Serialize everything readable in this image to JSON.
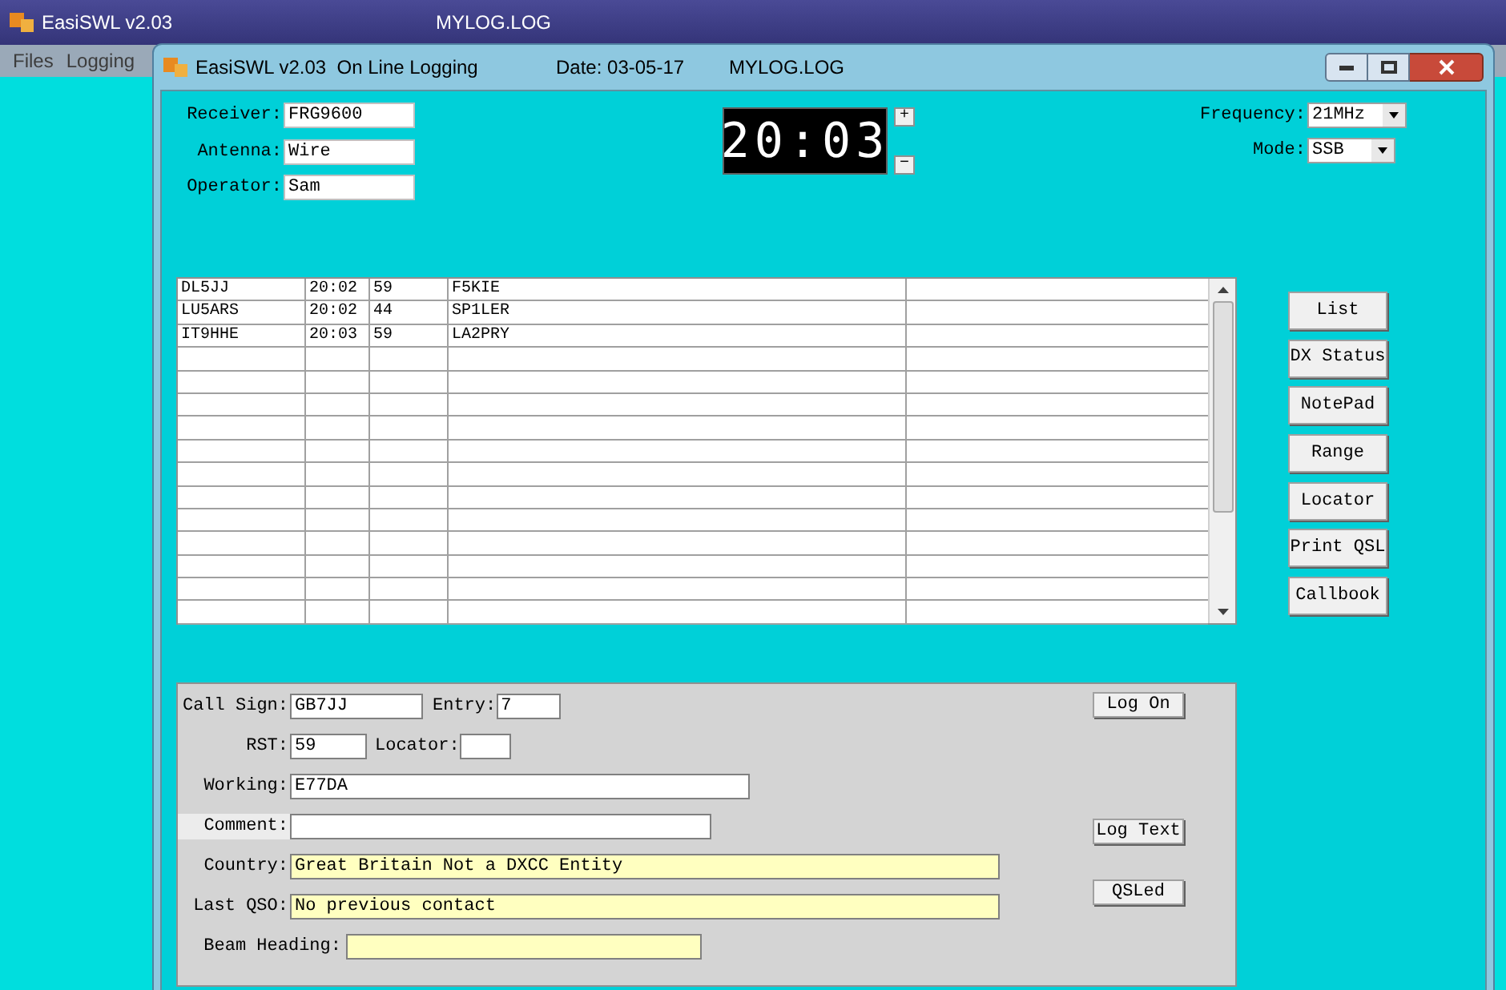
{
  "app_window": {
    "title": "EasiSWL v2.03",
    "file": "MYLOG.LOG",
    "menu": [
      "Files",
      "Logging"
    ]
  },
  "log_window": {
    "title": "EasiSWL v2.03  On Line Logging",
    "date": "Date: 03-05-17",
    "file": "MYLOG.LOG"
  },
  "station": [
    {
      "label": "Receiver:",
      "value": "FRG9600"
    },
    {
      "label": "Antenna:",
      "value": "Wire"
    },
    {
      "label": "Operator:",
      "value": "Sam"
    }
  ],
  "clock": {
    "time": "20:03",
    "increment": "+",
    "decrement": "−"
  },
  "selectors": [
    {
      "label": "Frequency:",
      "value": "21MHz"
    },
    {
      "label": "Mode:",
      "value": "SSB"
    }
  ],
  "log_table": {
    "rows": [
      [
        "DL5JJ",
        "20:02",
        "59",
        "F5KIE"
      ],
      [
        "LU5ARS",
        "20:02",
        "44",
        "SP1LER"
      ],
      [
        "IT9HHE",
        "20:03",
        "59",
        "LA2PRY"
      ]
    ]
  },
  "side_buttons": [
    "List",
    "DX Status",
    "NotePad",
    "Range",
    "Locator",
    "Print QSL",
    "Callbook"
  ],
  "entry_form": {
    "fields": [
      {
        "label": "Call Sign:",
        "value": "GB7JJ",
        "kind": "text",
        "highlighted": false
      },
      {
        "label": "Entry:",
        "value": "7",
        "kind": "text",
        "highlighted": false
      },
      {
        "label": "RST:",
        "value": "59",
        "kind": "text",
        "highlighted": false
      },
      {
        "label": "Locator:",
        "kind": "text",
        "highlighted": false
      },
      {
        "label": "Working:",
        "value": "E77DA",
        "kind": "text",
        "highlighted": false
      },
      {
        "label": "Comment:",
        "kind": "text",
        "highlighted": true
      },
      {
        "label": "Country:",
        "value": "Great Britain Not a DXCC Entity",
        "kind": "readonly",
        "highlighted": false
      },
      {
        "label": "Last QSO:",
        "value": "No previous contact",
        "kind": "readonly",
        "highlighted": false
      },
      {
        "label": "Beam Heading:",
        "kind": "readonly",
        "highlighted": false
      }
    ],
    "buttons": [
      "Log On",
      "Log Text",
      "QSLed"
    ]
  }
}
